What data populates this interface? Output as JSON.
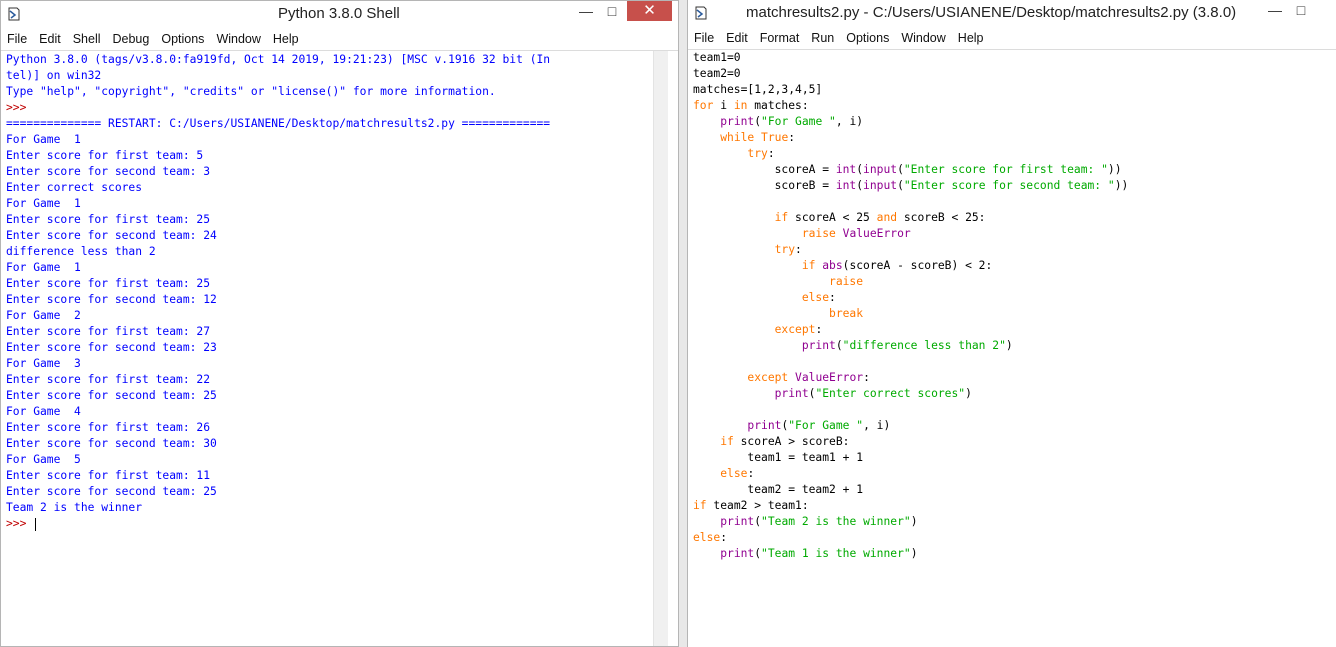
{
  "shell": {
    "title": "Python 3.8.0 Shell",
    "menu": [
      "File",
      "Edit",
      "Shell",
      "Debug",
      "Options",
      "Window",
      "Help"
    ],
    "controls": {
      "minimize": "—",
      "maximize": "□",
      "close": "✕"
    },
    "lines": [
      {
        "t": "Python 3.8.0 (tags/v3.8.0:fa919fd, Oct 14 2019, 19:21:23) [MSC v.1916 32 bit (In",
        "c": "out"
      },
      {
        "t": "tel)] on win32",
        "c": "out"
      },
      {
        "t": "Type \"help\", \"copyright\", \"credits\" or \"license()\" for more information.",
        "c": "out"
      },
      {
        "t": ">>> ",
        "c": "ps"
      },
      {
        "t": "============== RESTART: C:/Users/USIANENE/Desktop/matchresults2.py =============",
        "c": "out"
      },
      {
        "t": "For Game  1",
        "c": "out"
      },
      {
        "t": "Enter score for first team: 5",
        "c": "out"
      },
      {
        "t": "Enter score for second team: 3",
        "c": "out"
      },
      {
        "t": "Enter correct scores",
        "c": "out"
      },
      {
        "t": "For Game  1",
        "c": "out"
      },
      {
        "t": "Enter score for first team: 25",
        "c": "out"
      },
      {
        "t": "Enter score for second team: 24",
        "c": "out"
      },
      {
        "t": "difference less than 2",
        "c": "out"
      },
      {
        "t": "For Game  1",
        "c": "out"
      },
      {
        "t": "Enter score for first team: 25",
        "c": "out"
      },
      {
        "t": "Enter score for second team: 12",
        "c": "out"
      },
      {
        "t": "For Game  2",
        "c": "out"
      },
      {
        "t": "Enter score for first team: 27",
        "c": "out"
      },
      {
        "t": "Enter score for second team: 23",
        "c": "out"
      },
      {
        "t": "For Game  3",
        "c": "out"
      },
      {
        "t": "Enter score for first team: 22",
        "c": "out"
      },
      {
        "t": "Enter score for second team: 25",
        "c": "out"
      },
      {
        "t": "For Game  4",
        "c": "out"
      },
      {
        "t": "Enter score for first team: 26",
        "c": "out"
      },
      {
        "t": "Enter score for second team: 30",
        "c": "out"
      },
      {
        "t": "For Game  5",
        "c": "out"
      },
      {
        "t": "Enter score for first team: 11",
        "c": "out"
      },
      {
        "t": "Enter score for second team: 25",
        "c": "out"
      },
      {
        "t": "Team 2 is the winner",
        "c": "out"
      },
      {
        "t": ">>> ",
        "c": "ps",
        "cursor": true
      }
    ]
  },
  "editor": {
    "title": "matchresults2.py - C:/Users/USIANENE/Desktop/matchresults2.py (3.8.0)",
    "menu": [
      "File",
      "Edit",
      "Format",
      "Run",
      "Options",
      "Window",
      "Help"
    ],
    "controls": {
      "minimize": "—",
      "maximize": "□"
    },
    "lines": [
      [
        [
          "team1=0",
          ""
        ]
      ],
      [
        [
          "team2=0",
          ""
        ]
      ],
      [
        [
          "matches=[1,2,3,4,5]",
          ""
        ]
      ],
      [
        [
          "for",
          "kw"
        ],
        [
          " i ",
          ""
        ],
        [
          "in",
          "kw"
        ],
        [
          " matches:",
          ""
        ]
      ],
      [
        [
          "    ",
          ""
        ],
        [
          "print",
          "bi"
        ],
        [
          "(",
          ""
        ],
        [
          "\"For Game \"",
          "st"
        ],
        [
          ", i)",
          ""
        ]
      ],
      [
        [
          "    ",
          ""
        ],
        [
          "while",
          "kw"
        ],
        [
          " ",
          ""
        ],
        [
          "True",
          "kw"
        ],
        [
          ":",
          ""
        ]
      ],
      [
        [
          "        ",
          ""
        ],
        [
          "try",
          "kw"
        ],
        [
          ":",
          ""
        ]
      ],
      [
        [
          "            scoreA = ",
          ""
        ],
        [
          "int",
          "bi"
        ],
        [
          "(",
          ""
        ],
        [
          "input",
          "bi"
        ],
        [
          "(",
          ""
        ],
        [
          "\"Enter score for first team: \"",
          "st"
        ],
        [
          "))",
          ""
        ]
      ],
      [
        [
          "            scoreB = ",
          ""
        ],
        [
          "int",
          "bi"
        ],
        [
          "(",
          ""
        ],
        [
          "input",
          "bi"
        ],
        [
          "(",
          ""
        ],
        [
          "\"Enter score for second team: \"",
          "st"
        ],
        [
          "))",
          ""
        ]
      ],
      [
        [
          "",
          ""
        ]
      ],
      [
        [
          "            ",
          ""
        ],
        [
          "if",
          "kw"
        ],
        [
          " scoreA < 25 ",
          ""
        ],
        [
          "and",
          "kw"
        ],
        [
          " scoreB < 25:",
          ""
        ]
      ],
      [
        [
          "                ",
          ""
        ],
        [
          "raise",
          "kw"
        ],
        [
          " ",
          ""
        ],
        [
          "ValueError",
          "bi"
        ]
      ],
      [
        [
          "            ",
          ""
        ],
        [
          "try",
          "kw"
        ],
        [
          ":",
          ""
        ]
      ],
      [
        [
          "                ",
          ""
        ],
        [
          "if",
          "kw"
        ],
        [
          " ",
          ""
        ],
        [
          "abs",
          "bi"
        ],
        [
          "(scoreA - scoreB) < 2:",
          ""
        ]
      ],
      [
        [
          "                    ",
          ""
        ],
        [
          "raise",
          "kw"
        ]
      ],
      [
        [
          "                ",
          ""
        ],
        [
          "else",
          "kw"
        ],
        [
          ":",
          ""
        ]
      ],
      [
        [
          "                    ",
          ""
        ],
        [
          "break",
          "kw"
        ]
      ],
      [
        [
          "            ",
          ""
        ],
        [
          "except",
          "kw"
        ],
        [
          ":",
          ""
        ]
      ],
      [
        [
          "                ",
          ""
        ],
        [
          "print",
          "bi"
        ],
        [
          "(",
          ""
        ],
        [
          "\"difference less than 2\"",
          "st"
        ],
        [
          ")",
          ""
        ]
      ],
      [
        [
          "",
          ""
        ]
      ],
      [
        [
          "        ",
          ""
        ],
        [
          "except",
          "kw"
        ],
        [
          " ",
          ""
        ],
        [
          "ValueError",
          "bi"
        ],
        [
          ":",
          ""
        ]
      ],
      [
        [
          "            ",
          ""
        ],
        [
          "print",
          "bi"
        ],
        [
          "(",
          ""
        ],
        [
          "\"Enter correct scores\"",
          "st"
        ],
        [
          ")",
          ""
        ]
      ],
      [
        [
          "",
          ""
        ]
      ],
      [
        [
          "        ",
          ""
        ],
        [
          "print",
          "bi"
        ],
        [
          "(",
          ""
        ],
        [
          "\"For Game \"",
          "st"
        ],
        [
          ", i)",
          ""
        ]
      ],
      [
        [
          "    ",
          ""
        ],
        [
          "if",
          "kw"
        ],
        [
          " scoreA > scoreB:",
          ""
        ]
      ],
      [
        [
          "        team1 = team1 + 1",
          ""
        ]
      ],
      [
        [
          "    ",
          ""
        ],
        [
          "else",
          "kw"
        ],
        [
          ":",
          ""
        ]
      ],
      [
        [
          "        team2 = team2 + 1",
          ""
        ]
      ],
      [
        [
          "if",
          "kw"
        ],
        [
          " team2 > team1:",
          ""
        ]
      ],
      [
        [
          "    ",
          ""
        ],
        [
          "print",
          "bi"
        ],
        [
          "(",
          ""
        ],
        [
          "\"Team 2 is the winner\"",
          "st"
        ],
        [
          ")",
          ""
        ]
      ],
      [
        [
          "else",
          "kw"
        ],
        [
          ":",
          ""
        ]
      ],
      [
        [
          "    ",
          ""
        ],
        [
          "print",
          "bi"
        ],
        [
          "(",
          ""
        ],
        [
          "\"Team 1 is the winner\"",
          "st"
        ],
        [
          ")",
          ""
        ]
      ]
    ]
  }
}
